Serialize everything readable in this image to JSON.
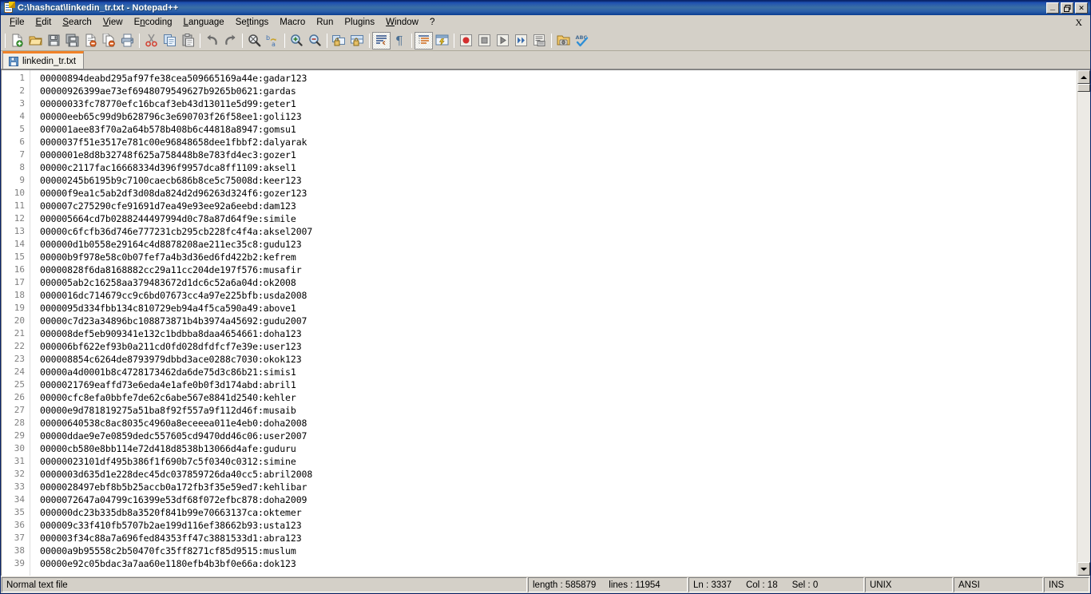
{
  "window": {
    "title": "C:\\hashcat\\linkedin_tr.txt - Notepad++",
    "icon": "notepad-plus-plus-icon",
    "minimize_label": "_",
    "maximize_label": "❐",
    "close_label": "✕"
  },
  "menu": {
    "items": [
      {
        "label": "File",
        "accel": "F"
      },
      {
        "label": "Edit",
        "accel": "E"
      },
      {
        "label": "Search",
        "accel": "S"
      },
      {
        "label": "View",
        "accel": "V"
      },
      {
        "label": "Encoding",
        "accel": "n"
      },
      {
        "label": "Language",
        "accel": "L"
      },
      {
        "label": "Settings",
        "accel": "t"
      },
      {
        "label": "Macro",
        "accel": ""
      },
      {
        "label": "Run",
        "accel": ""
      },
      {
        "label": "Plugins",
        "accel": ""
      },
      {
        "label": "Window",
        "accel": "W"
      },
      {
        "label": "?",
        "accel": ""
      }
    ],
    "close_document": "X"
  },
  "toolbar": {
    "buttons": [
      {
        "name": "new-file-icon",
        "tooltip": "New"
      },
      {
        "name": "open-file-icon",
        "tooltip": "Open"
      },
      {
        "name": "save-icon",
        "tooltip": "Save"
      },
      {
        "name": "save-all-icon",
        "tooltip": "Save All"
      },
      {
        "name": "close-file-icon",
        "tooltip": "Close"
      },
      {
        "name": "close-all-files-icon",
        "tooltip": "Close All"
      },
      {
        "name": "print-icon",
        "tooltip": "Print"
      },
      {
        "name": "cut-icon",
        "tooltip": "Cut"
      },
      {
        "name": "copy-icon",
        "tooltip": "Copy"
      },
      {
        "name": "paste-icon",
        "tooltip": "Paste"
      },
      {
        "name": "undo-icon",
        "tooltip": "Undo"
      },
      {
        "name": "redo-icon",
        "tooltip": "Redo"
      },
      {
        "name": "find-icon",
        "tooltip": "Find"
      },
      {
        "name": "replace-icon",
        "tooltip": "Replace"
      },
      {
        "name": "zoom-in-icon",
        "tooltip": "Zoom In"
      },
      {
        "name": "zoom-out-icon",
        "tooltip": "Zoom Out"
      },
      {
        "name": "sync-vertical-scroll-icon",
        "tooltip": "Synchronize Vertical Scrolling"
      },
      {
        "name": "sync-horizontal-scroll-icon",
        "tooltip": "Synchronize Horizontal Scrolling"
      },
      {
        "name": "word-wrap-icon",
        "tooltip": "Word wrap"
      },
      {
        "name": "show-all-characters-icon",
        "tooltip": "Show All Characters"
      },
      {
        "name": "indent-guide-icon",
        "tooltip": "Show Indent Guide"
      },
      {
        "name": "user-defined-dialog-icon",
        "tooltip": "User Defined Dialogue"
      },
      {
        "name": "macro-record-icon",
        "tooltip": "Start Recording"
      },
      {
        "name": "macro-stop-icon",
        "tooltip": "Stop Recording"
      },
      {
        "name": "macro-play-icon",
        "tooltip": "Playback"
      },
      {
        "name": "macro-playback-multiple-icon",
        "tooltip": "Run a Macro Multiple Times"
      },
      {
        "name": "macro-save-icon",
        "tooltip": "Save Current Recorded Macro"
      },
      {
        "name": "folder-as-workspace-icon",
        "tooltip": "Open Folder as Workspace"
      },
      {
        "name": "spell-check-icon",
        "tooltip": "Spell Checker"
      }
    ]
  },
  "tabs": [
    {
      "label": "linkedin_tr.txt",
      "icon": "saved-document-icon",
      "active": true
    }
  ],
  "editor": {
    "first_line_number": 1,
    "lines": [
      "00000894deabd295af97fe38cea509665169a44e:gadar123",
      "00000926399ae73ef6948079549627b9265b0621:gardas",
      "00000033fc78770efc16bcaf3eb43d13011e5d99:geter1",
      "00000eeb65c99d9b628796c3e690703f26f58ee1:goli123",
      "000001aee83f70a2a64b578b408b6c44818a8947:gomsu1",
      "0000037f51e3517e781c00e96848658dee1fbbf2:dalyarak",
      "0000001e8d8b32748f625a758448b8e783fd4ec3:gozer1",
      "00000c2117fac16668334d396f9957dca8ff1109:aksel1",
      "00000245b6195b9c7100caecb686b8ce5c75008d:keer123",
      "00000f9ea1c5ab2df3d08da824d2d96263d324f6:gozer123",
      "000007c275290cfe91691d7ea49e93ee92a6eebd:dam123",
      "000005664cd7b0288244497994d0c78a87d64f9e:simile",
      "00000c6fcfb36d746e777231cb295cb228fc4f4a:aksel2007",
      "000000d1b0558e29164c4d8878208ae211ec35c8:gudu123",
      "00000b9f978e58c0b07fef7a4b3d36ed6fd422b2:kefrem",
      "00000828f6da8168882cc29a11cc204de197f576:musafir",
      "000005ab2c16258aa379483672d1dc6c52a6a04d:ok2008",
      "0000016dc714679cc9c6bd07673cc4a97e225bfb:usda2008",
      "0000095d334fbb134c810729eb94a4f5ca590a49:above1",
      "00000c7d23a34896bc108873871b4b3974a45692:gudu2007",
      "000008def5eb909341e132c1bdbba8daa4654661:doha123",
      "000006bf622ef93b0a211cd0fd028dfdfcf7e39e:user123",
      "000008854c6264de8793979dbbd3ace0288c7030:okok123",
      "00000a4d0001b8c4728173462da6de75d3c86b21:simis1",
      "0000021769eaffd73e6eda4e1afe0b0f3d174abd:abril1",
      "00000cfc8efa0bbfe7de62c6abe567e8841d2540:kehler",
      "00000e9d781819275a51ba8f92f557a9f112d46f:musaib",
      "00000640538c8ac8035c4960a8eceeea011e4eb0:doha2008",
      "00000ddae9e7e0859dedc557605cd9470dd46c06:user2007",
      "00000cb580e8bb114e72d418d8538b13066d4afe:guduru",
      "00000023101df495b386f1f690b7c5f0340c0312:simine",
      "0000003d635d1e228dec45dc037859726da40cc5:abril2008",
      "0000028497ebf8b5b25accb0a172fb3f35e59ed7:kehlibar",
      "0000072647a04799c16399e53df68f072efbc878:doha2009",
      "000000dc23b335db8a3520f841b99e70663137ca:oktemer",
      "000009c33f410fb5707b2ae199d116ef38662b93:usta123",
      "000003f34c88a7a696fed84353ff47c3881533d1:abra123",
      "00000a9b95558c2b50470fc35ff8271cf85d9515:muslum",
      "00000e92c05bdac3a7aa60e1180efb4b3bf0e66a:dok123"
    ]
  },
  "status": {
    "file_type": "Normal text file",
    "length_label": "length : 585879",
    "lines_label": "lines : 11954",
    "ln": "Ln : 3337",
    "col": "Col : 18",
    "sel": "Sel : 0",
    "eol": "UNIX",
    "encoding": "ANSI",
    "insert_mode": "INS"
  },
  "colors": {
    "titlebar_start": "#0a246a",
    "titlebar_end": "#3a6ea5",
    "chrome": "#d4d0c8",
    "editor_bg": "#ffffff",
    "text": "#000000",
    "line_number": "#808080",
    "tab_accent": "#f08228"
  }
}
